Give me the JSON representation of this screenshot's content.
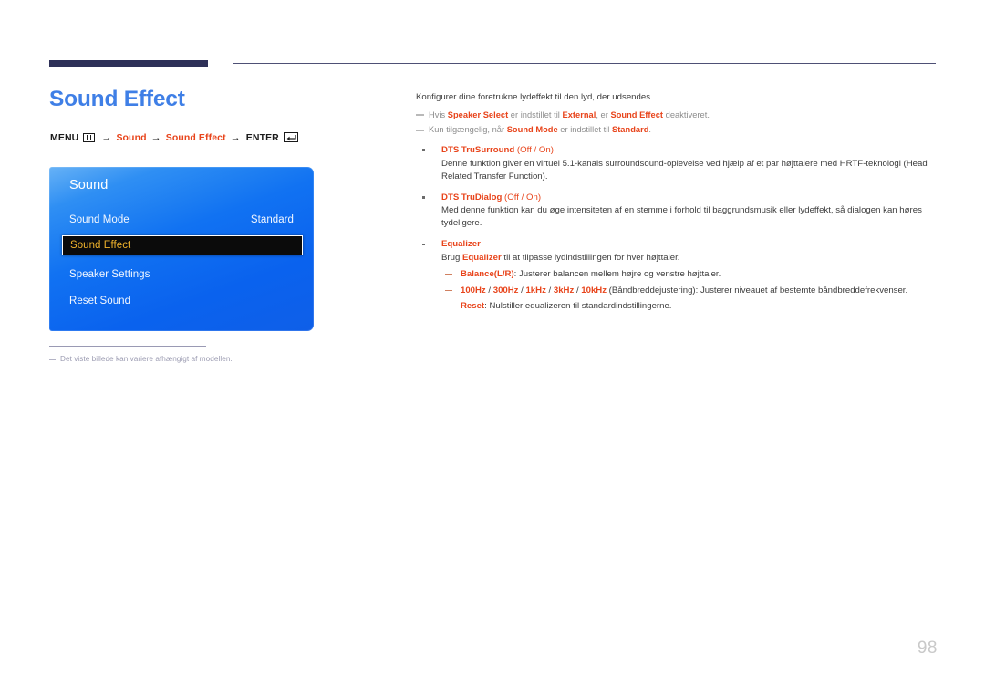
{
  "page": {
    "title": "Sound Effect",
    "number": "98",
    "title_color": "#3f7fe6",
    "accent_color": "#e8441b",
    "rule_color": "#2e3058"
  },
  "menu_path": {
    "menu_label": "MENU",
    "menu_icon": "menu-grid-icon",
    "arrow": "→",
    "step1": "Sound",
    "step2": "Sound Effect",
    "enter_label": "ENTER",
    "enter_icon": "enter-return-icon"
  },
  "osd": {
    "title": "Sound",
    "rows": [
      {
        "label": "Sound Mode",
        "value": "Standard",
        "selected": false
      },
      {
        "label": "Sound Effect",
        "value": "",
        "selected": true
      },
      {
        "label": "Speaker Settings",
        "value": "",
        "selected": false
      },
      {
        "label": "Reset Sound",
        "value": "",
        "selected": false
      }
    ],
    "highlight_text_color": "#f0b32c",
    "highlight_bg_color": "#0b0b0b"
  },
  "left_note": "Det viste billede kan variere afhængigt af modellen.",
  "content": {
    "intro": "Konfigurer dine foretrukne lydeffekt til den lyd, der udsendes.",
    "notes": [
      {
        "parts": [
          {
            "t": "Hvis ",
            "b": false
          },
          {
            "t": "Speaker Select",
            "b": true
          },
          {
            "t": " er indstillet til ",
            "b": false
          },
          {
            "t": "External",
            "b": true
          },
          {
            "t": ", er ",
            "b": false
          },
          {
            "t": "Sound Effect",
            "b": true
          },
          {
            "t": " deaktiveret.",
            "b": false
          }
        ]
      },
      {
        "parts": [
          {
            "t": "Kun tilgængelig, når ",
            "b": false
          },
          {
            "t": "Sound Mode",
            "b": true
          },
          {
            "t": " er indstillet til ",
            "b": false
          },
          {
            "t": "Standard",
            "b": true
          },
          {
            "t": ".",
            "b": false
          }
        ]
      }
    ],
    "bullets": [
      {
        "name": "dts-trusurround",
        "head": "DTS TruSurround",
        "options": "(Off / On)",
        "body_parts": [
          {
            "t": "Denne funktion giver en virtuel 5.1-kanals surroundsound-oplevelse ved hjælp af et par højttalere med HRTF-teknologi (Head Related Transfer Function).",
            "b": false
          }
        ],
        "subitems": []
      },
      {
        "name": "dts-trudialog",
        "head": "DTS TruDialog",
        "options": "(Off / On)",
        "body_parts": [
          {
            "t": "Med denne funktion kan du øge intensiteten af en stemme i forhold til baggrundsmusik eller lydeffekt, så dialogen kan høres tydeligere.",
            "b": false
          }
        ],
        "subitems": []
      },
      {
        "name": "equalizer",
        "head": "Equalizer",
        "options": "",
        "body_parts": [
          {
            "t": "Brug ",
            "b": false
          },
          {
            "t": "Equalizer",
            "b": true
          },
          {
            "t": " til at tilpasse lydindstillingen for hver højttaler.",
            "b": false
          }
        ],
        "subitems": [
          {
            "parts": [
              {
                "t": "Balance(L/R)",
                "b": true
              },
              {
                "t": ": Justerer balancen mellem højre og venstre højttaler.",
                "b": false
              }
            ]
          },
          {
            "parts": [
              {
                "t": "100Hz",
                "b": true
              },
              {
                "t": " / ",
                "b": false
              },
              {
                "t": "300Hz",
                "b": true
              },
              {
                "t": " / ",
                "b": false
              },
              {
                "t": "1kHz",
                "b": true
              },
              {
                "t": " / ",
                "b": false
              },
              {
                "t": "3kHz",
                "b": true
              },
              {
                "t": " / ",
                "b": false
              },
              {
                "t": "10kHz",
                "b": true
              },
              {
                "t": " (Båndbreddejustering): Justerer niveauet af bestemte båndbreddefrekvenser.",
                "b": false
              }
            ]
          },
          {
            "parts": [
              {
                "t": "Reset",
                "b": true
              },
              {
                "t": ": Nulstiller equalizeren til standardindstillingerne.",
                "b": false
              }
            ]
          }
        ]
      }
    ]
  }
}
